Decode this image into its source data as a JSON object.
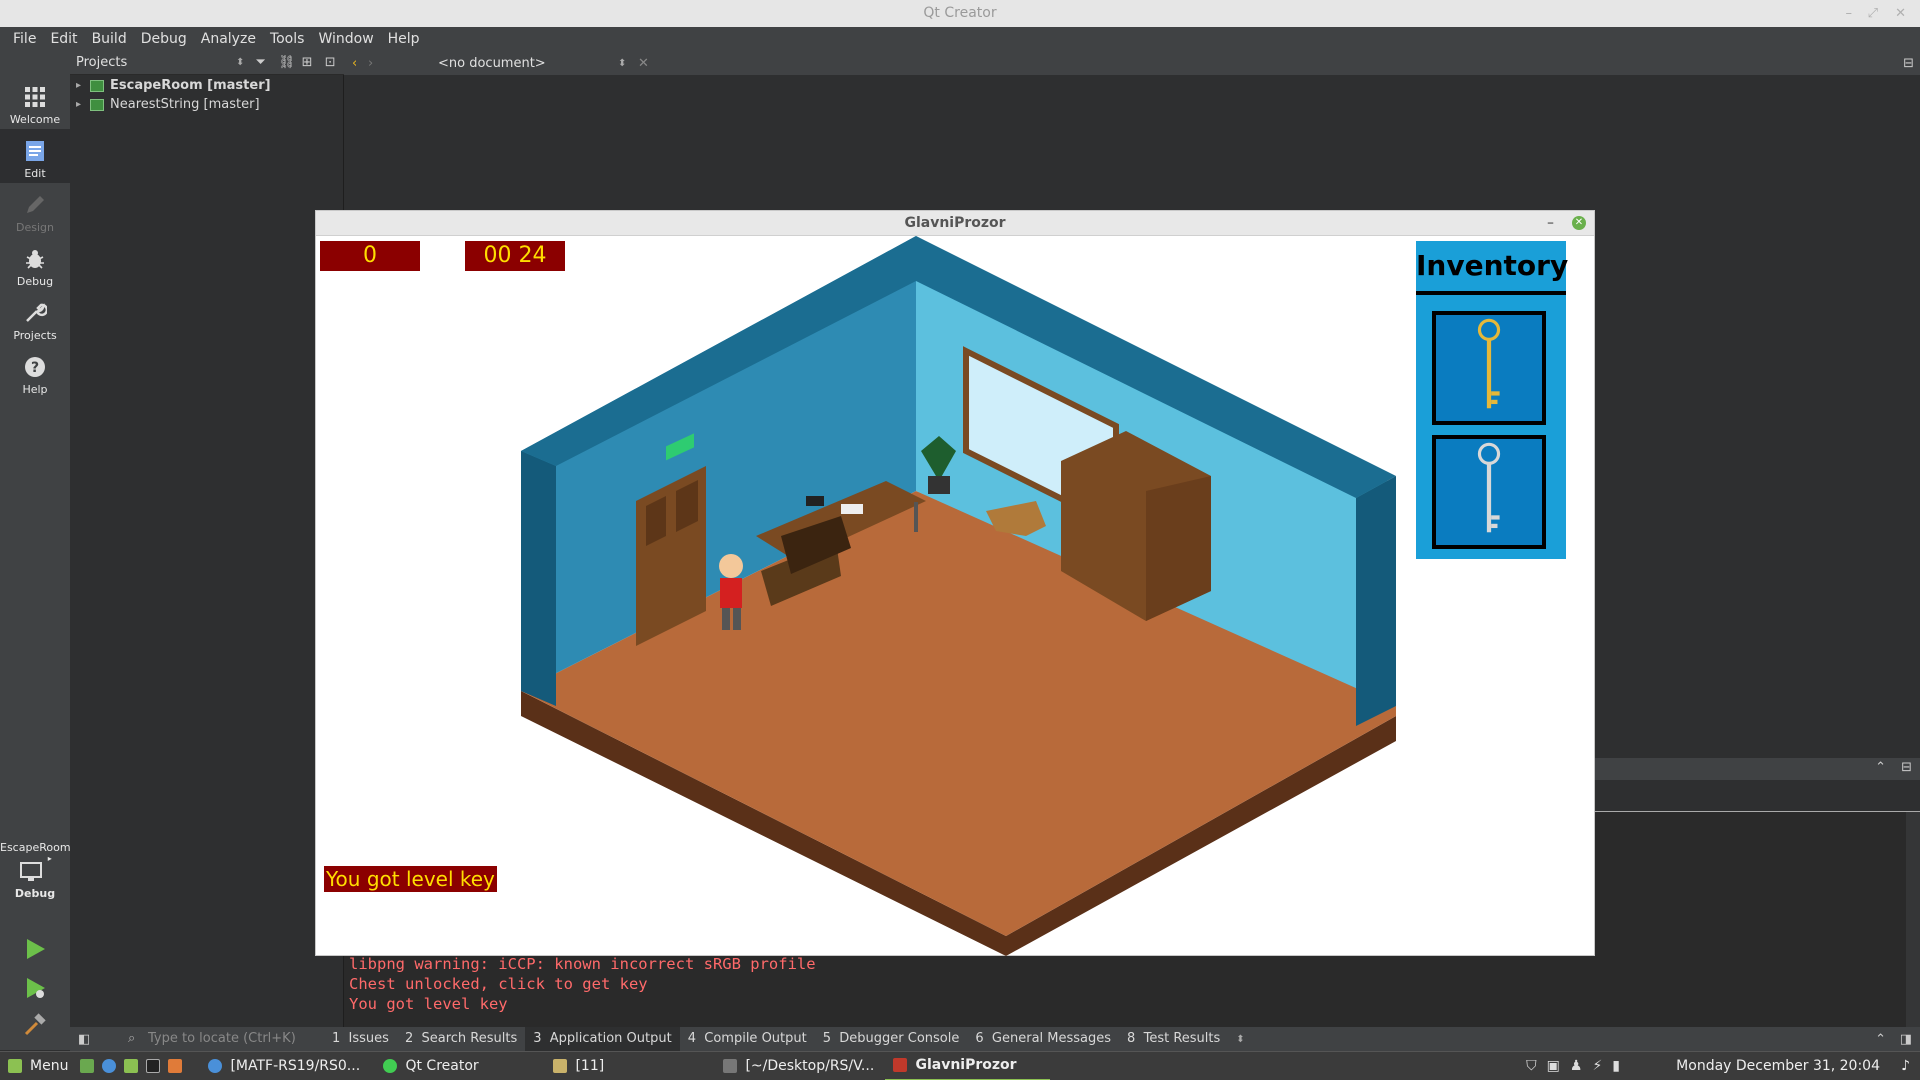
{
  "window_title": "Qt Creator",
  "menu": [
    "File",
    "Edit",
    "Build",
    "Debug",
    "Analyze",
    "Tools",
    "Window",
    "Help"
  ],
  "modes": [
    {
      "label": "Welcome"
    },
    {
      "label": "Edit"
    },
    {
      "label": "Design"
    },
    {
      "label": "Debug"
    },
    {
      "label": "Projects"
    },
    {
      "label": "Help"
    }
  ],
  "kit": {
    "project": "EscapeRoom",
    "config": "Debug"
  },
  "projects_panel": {
    "label": "Projects",
    "items": [
      "EscapeRoom [master]",
      "NearestString [master]"
    ]
  },
  "editor": {
    "document": "<no document>"
  },
  "output_lines": [
    "libpng warning: iCCP: known incorrect sRGB profile",
    "Chest unlocked, click to get key",
    "You got level key"
  ],
  "locator": {
    "placeholder": "Type to locate (Ctrl+K)"
  },
  "output_tabs": [
    {
      "num": "1",
      "label": "Issues"
    },
    {
      "num": "2",
      "label": "Search Results"
    },
    {
      "num": "3",
      "label": "Application Output"
    },
    {
      "num": "4",
      "label": "Compile Output"
    },
    {
      "num": "5",
      "label": "Debugger Console"
    },
    {
      "num": "6",
      "label": "General Messages"
    },
    {
      "num": "8",
      "label": "Test Results"
    }
  ],
  "game": {
    "title": "GlavniProzor",
    "score": "0",
    "timer": "00 24",
    "inventory_title": "Inventory",
    "message": "You got level key",
    "inventory_items": [
      "gold-key-icon",
      "silver-key-icon"
    ]
  },
  "taskbar": {
    "menu": "Menu",
    "items": [
      "[MATF-RS19/RS0...",
      "Qt Creator",
      "[11]",
      "[~/Desktop/RS/V...",
      "GlavniProzor"
    ],
    "clock": "Monday December 31, 20:04"
  }
}
